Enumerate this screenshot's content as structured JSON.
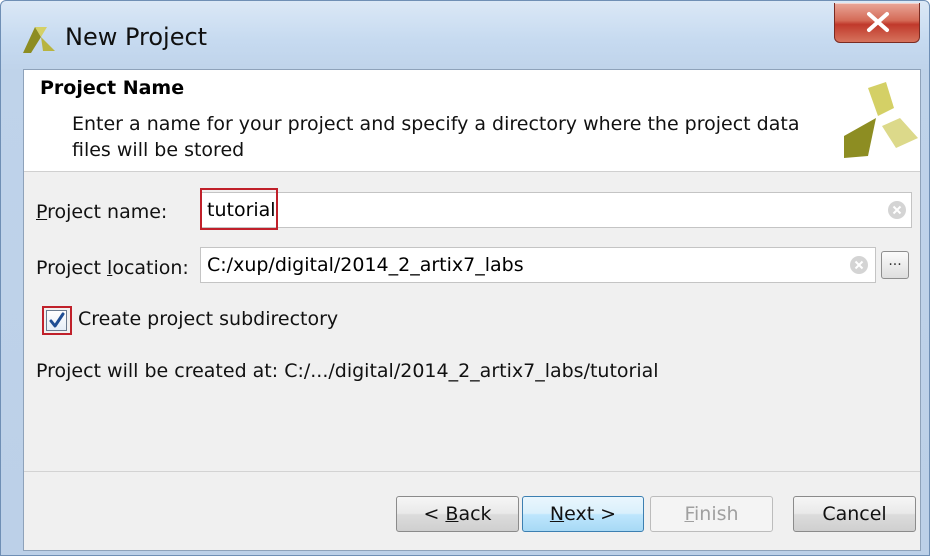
{
  "window": {
    "title": "New Project"
  },
  "header": {
    "title": "Project Name",
    "description": "Enter a name for your project and specify a directory where the project data files will be stored"
  },
  "form": {
    "project_name": {
      "label_mnemonic": "P",
      "label_rest": "roject name:",
      "value": "tutorial"
    },
    "project_location": {
      "label_pre": "Project ",
      "label_mnemonic": "l",
      "label_rest": "ocation:",
      "value": "C:/xup/digital/2014_2_artix7_labs",
      "browse_label": "..."
    },
    "create_subdirectory": {
      "label": "Create project subdirectory",
      "checked": true
    },
    "created_at": "Project will be created at: C:/.../digital/2014_2_artix7_labs/tutorial"
  },
  "buttons": {
    "back": {
      "pre": "< ",
      "mnemonic": "B",
      "rest": "ack"
    },
    "next": {
      "mnemonic": "N",
      "rest": "ext >"
    },
    "finish": {
      "mnemonic": "F",
      "rest": "inish",
      "disabled": true
    },
    "cancel": {
      "label": "Cancel"
    }
  },
  "colors": {
    "highlight_box": "#c0202a",
    "close_button": "#c0392b",
    "logo_yellow": "#d4d066",
    "logo_green": "#8d8d22"
  },
  "icons": {
    "app": "vivado-logo-icon",
    "close": "close-icon",
    "clear": "clear-field-icon",
    "check": "checkmark-icon",
    "header_logo": "xilinx-wizard-logo"
  }
}
